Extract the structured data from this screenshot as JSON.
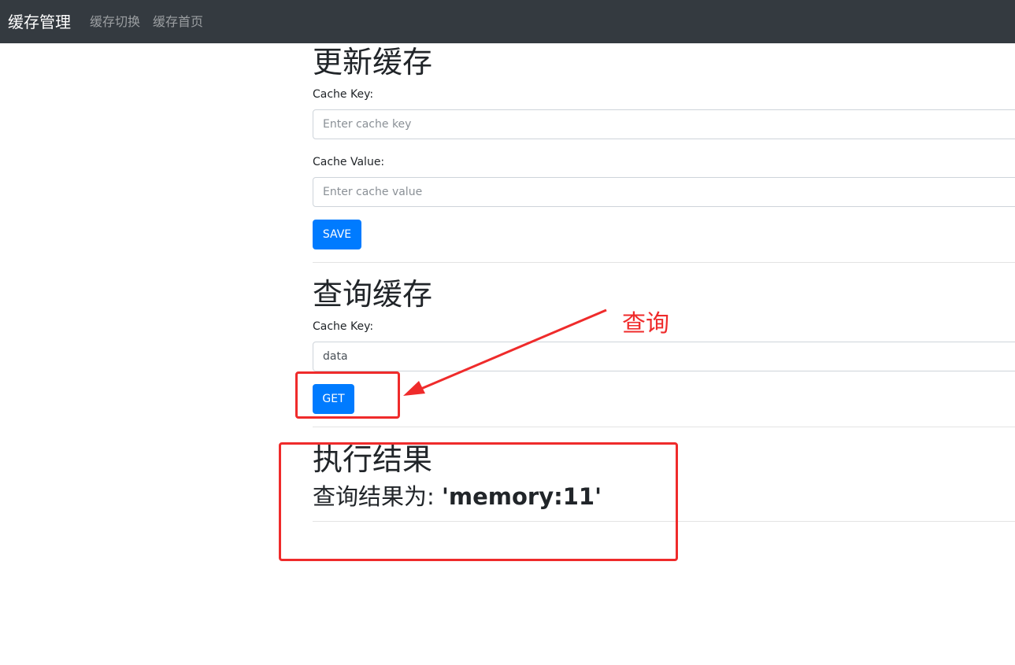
{
  "navbar": {
    "brand": "缓存管理",
    "links": [
      "缓存切换",
      "缓存首页"
    ]
  },
  "update_section": {
    "title": "更新缓存",
    "key_label": "Cache Key:",
    "key_placeholder": "Enter cache key",
    "key_value": "",
    "value_label": "Cache Value:",
    "value_placeholder": "Enter cache value",
    "value_value": "",
    "save_label": "SAVE"
  },
  "query_section": {
    "title": "查询缓存",
    "key_label": "Cache Key:",
    "key_value": "data",
    "get_label": "GET"
  },
  "result_section": {
    "title": "执行结果",
    "prefix": "查询结果为: ",
    "value": "'memory:11'"
  },
  "annotation": {
    "label": "查询",
    "color": "#ef2b2b"
  },
  "colors": {
    "navbar_bg": "#343a40",
    "primary": "#007bff"
  }
}
